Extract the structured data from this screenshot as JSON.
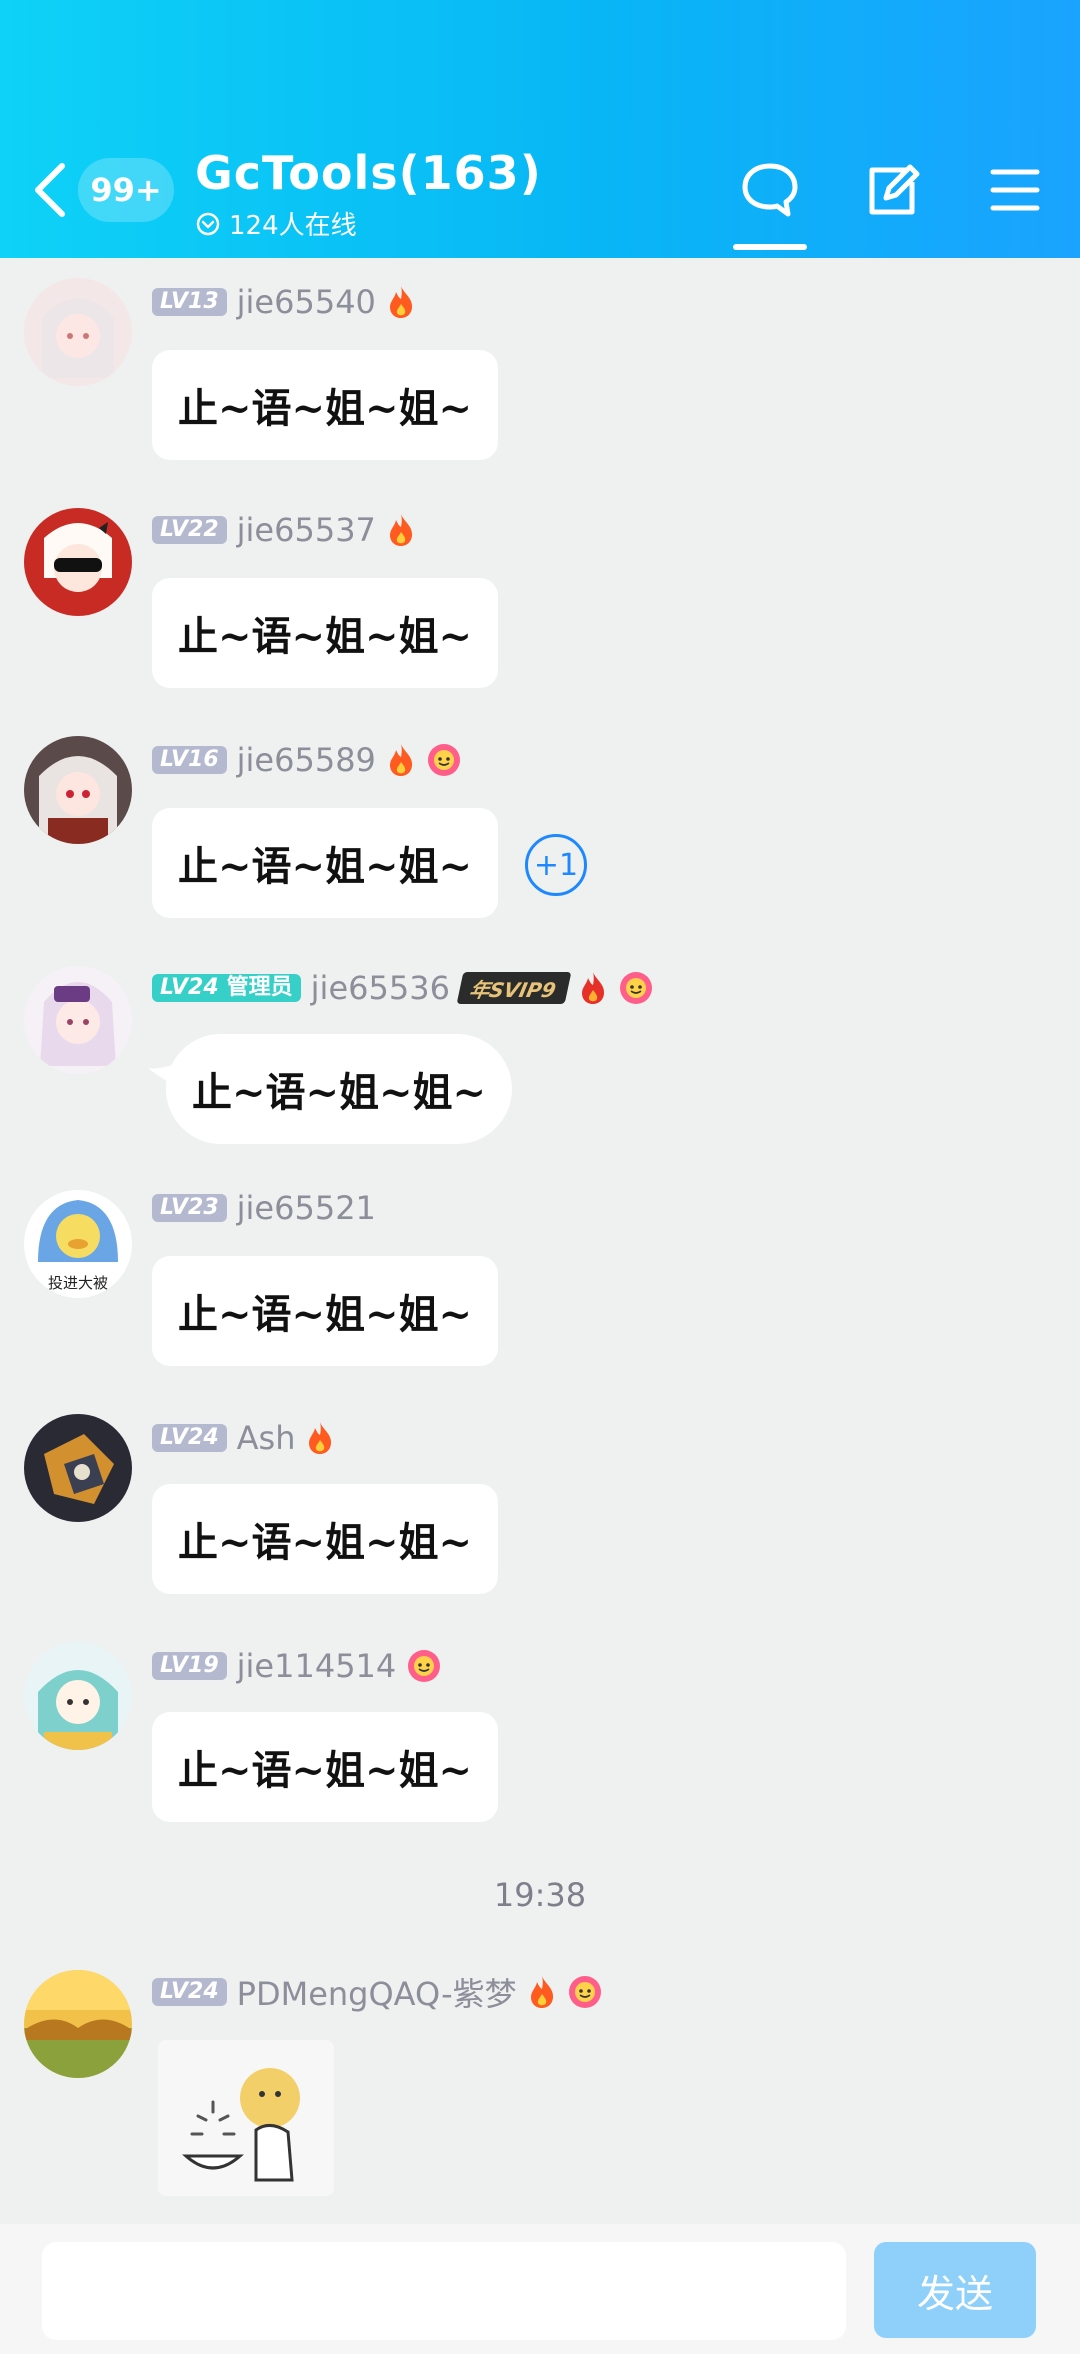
{
  "header": {
    "unread_badge": "99+",
    "group_title": "GcTools(163)",
    "online_text": "124人在线"
  },
  "messages": [
    {
      "level": "LV13",
      "name": "jie65540",
      "text": "止~语~姐~姐~"
    },
    {
      "level": "LV22",
      "name": "jie65537",
      "text": "止~语~姐~姐~"
    },
    {
      "level": "LV16",
      "name": "jie65589",
      "text": "止~语~姐~姐~",
      "plus_one": "+1"
    },
    {
      "level": "LV24",
      "role": "管理员",
      "name": "jie65536",
      "svip": "年SVIP9",
      "text": "止~语~姐~姐~"
    },
    {
      "level": "LV23",
      "name": "jie65521",
      "text": "止~语~姐~姐~",
      "avatar_text": "投进大被"
    },
    {
      "level": "LV24",
      "name": "Ash",
      "text": "止~语~姐~姐~"
    },
    {
      "level": "LV19",
      "name": "jie114514",
      "text": "止~语~姐~姐~"
    },
    {
      "level": "LV24",
      "name": "PDMengQAQ-紫梦"
    }
  ],
  "timestamp": "19:38",
  "input": {
    "value": "",
    "send_label": "发送"
  },
  "colors": {
    "header_start": "#0ed2f7",
    "header_end": "#1aa3ff",
    "level_badge": "#b5b9cf",
    "admin_badge": "#37d0c8",
    "send_button": "#8fd0fa",
    "background": "#eef1f0"
  },
  "icons": [
    "back-arrow-icon",
    "chat-bubble-icon",
    "edit-icon",
    "menu-icon",
    "fire-icon",
    "flower-icon"
  ]
}
